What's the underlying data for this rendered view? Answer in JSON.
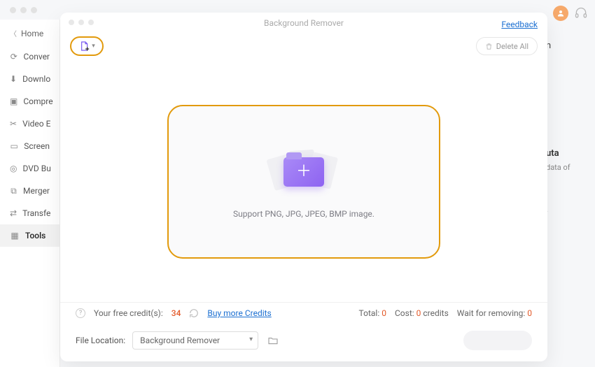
{
  "app": {
    "home": "Home"
  },
  "sidebar": {
    "items": [
      {
        "label": "Conver"
      },
      {
        "label": "Downlo"
      },
      {
        "label": "Compre"
      },
      {
        "label": "Video E"
      },
      {
        "label": "Screen"
      },
      {
        "label": "DVD Bu"
      },
      {
        "label": "Merger"
      },
      {
        "label": "Transfe"
      },
      {
        "label": "Tools"
      }
    ],
    "icons": [
      "loop",
      "download",
      "compress",
      "scissors",
      "screen",
      "disc",
      "merge",
      "transfer",
      "grid"
    ]
  },
  "right_fragments": {
    "n": "n",
    "uta": "uta",
    "data_of": "data of",
    "dot": "."
  },
  "modal": {
    "title": "Background Remover",
    "feedback": "Feedback",
    "delete_all": "Delete All",
    "drop_support": "Support PNG, JPG, JPEG, BMP image.",
    "credits": {
      "label": "Your free credit(s):",
      "value": "34",
      "buy": "Buy more Credits",
      "total_label": "Total:",
      "total_value": "0",
      "cost_label": "Cost:",
      "cost_value": "0",
      "cost_unit": "credits",
      "wait_label": "Wait for removing:",
      "wait_value": "0"
    },
    "file_location": {
      "label": "File Location:",
      "option": "Background Remover"
    },
    "primary": ""
  }
}
